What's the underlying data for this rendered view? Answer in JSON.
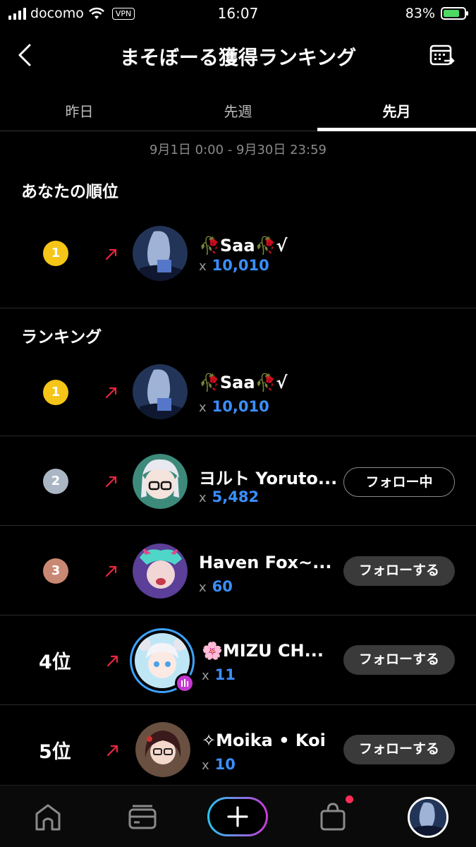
{
  "status_bar": {
    "carrier": "docomo",
    "vpn": "VPN",
    "time": "16:07",
    "battery": "83%"
  },
  "header": {
    "title": "まそぼーる獲得ランキング",
    "back_icon": "chevron-left-icon",
    "calendar_icon": "calendar-icon"
  },
  "tabs": [
    {
      "label": "昨日",
      "active": false
    },
    {
      "label": "先週",
      "active": false
    },
    {
      "label": "先月",
      "active": true
    }
  ],
  "date_range": "9月1日 0:00 - 9月30日 23:59",
  "my_rank": {
    "section_title": "あなたの順位",
    "rank": "1",
    "name": "🥀Saa🥀√",
    "score": "10,010",
    "x": "x"
  },
  "ranking": {
    "section_title": "ランキング",
    "rows": [
      {
        "rank": "1",
        "name": "🥀Saa🥀√",
        "score": "10,010",
        "x": "x",
        "button": ""
      },
      {
        "rank": "2",
        "name": "ヨルト Yoruto...",
        "score": "5,482",
        "x": "x",
        "button": "フォロー中"
      },
      {
        "rank": "3",
        "name": "Haven Fox~...",
        "score": "60",
        "x": "x",
        "button": "フォローする"
      },
      {
        "rank": "4位",
        "name": "🌸MIZU CH...",
        "score": "11",
        "x": "x",
        "button": "フォローする"
      },
      {
        "rank": "5位",
        "name": "✧Moika • Koi",
        "score": "10",
        "x": "x",
        "button": "フォローする"
      }
    ]
  },
  "colors": {
    "score_blue": "#3a8fff",
    "gold": "#f5c518",
    "silver": "#aab6c4",
    "bronze": "#c98873",
    "trend_red": "#e8273e"
  },
  "bottom_nav": [
    "home-icon",
    "wallet-icon",
    "plus-icon",
    "shop-bag-icon",
    "profile-avatar"
  ]
}
